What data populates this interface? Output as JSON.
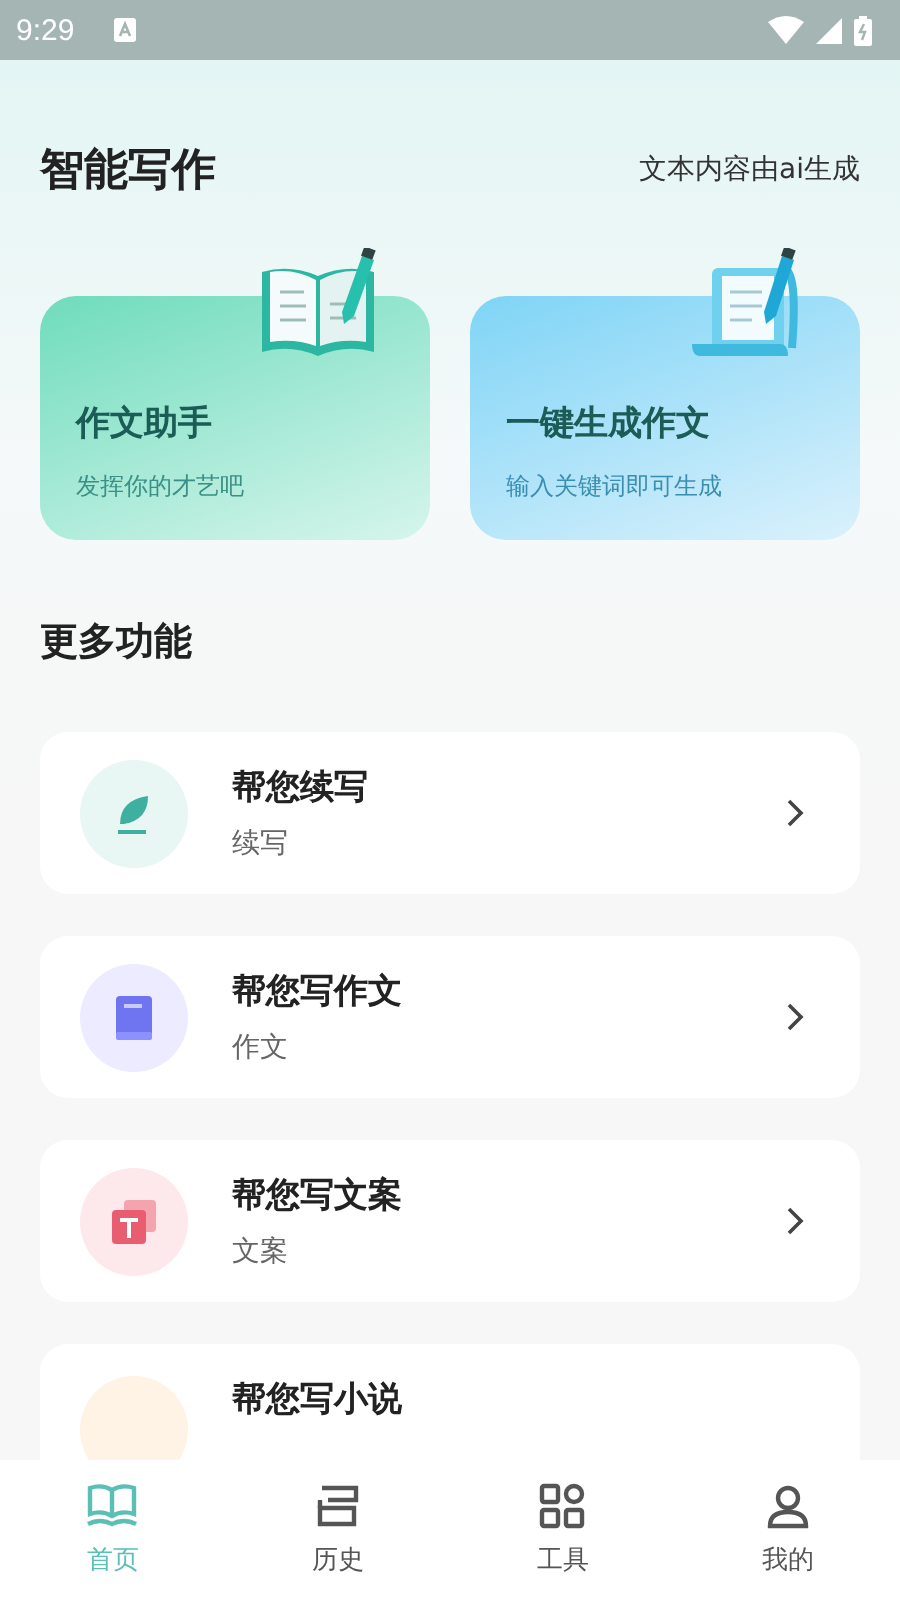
{
  "status_bar": {
    "time": "9:29"
  },
  "header": {
    "title": "智能写作",
    "note": "文本内容由ai生成"
  },
  "feature_cards": [
    {
      "kind": "essay",
      "title": "作文助手",
      "subtitle": "发挥你的才艺吧"
    },
    {
      "kind": "generate",
      "title": "一键生成作文",
      "subtitle": "输入关键词即可生成"
    }
  ],
  "more": {
    "title": "更多功能",
    "items": [
      {
        "kind": "continue",
        "title": "帮您续写",
        "subtitle": "续写"
      },
      {
        "kind": "essay",
        "title": "帮您写作文",
        "subtitle": "作文"
      },
      {
        "kind": "copy",
        "title": "帮您写文案",
        "subtitle": "文案"
      },
      {
        "kind": "novel",
        "title": "帮您写小说"
      }
    ]
  },
  "tabs": [
    {
      "kind": "home",
      "label": "首页",
      "selected": true
    },
    {
      "kind": "history",
      "label": "历史",
      "selected": false
    },
    {
      "kind": "tools",
      "label": "工具",
      "selected": false
    },
    {
      "kind": "me",
      "label": "我的",
      "selected": false
    }
  ]
}
